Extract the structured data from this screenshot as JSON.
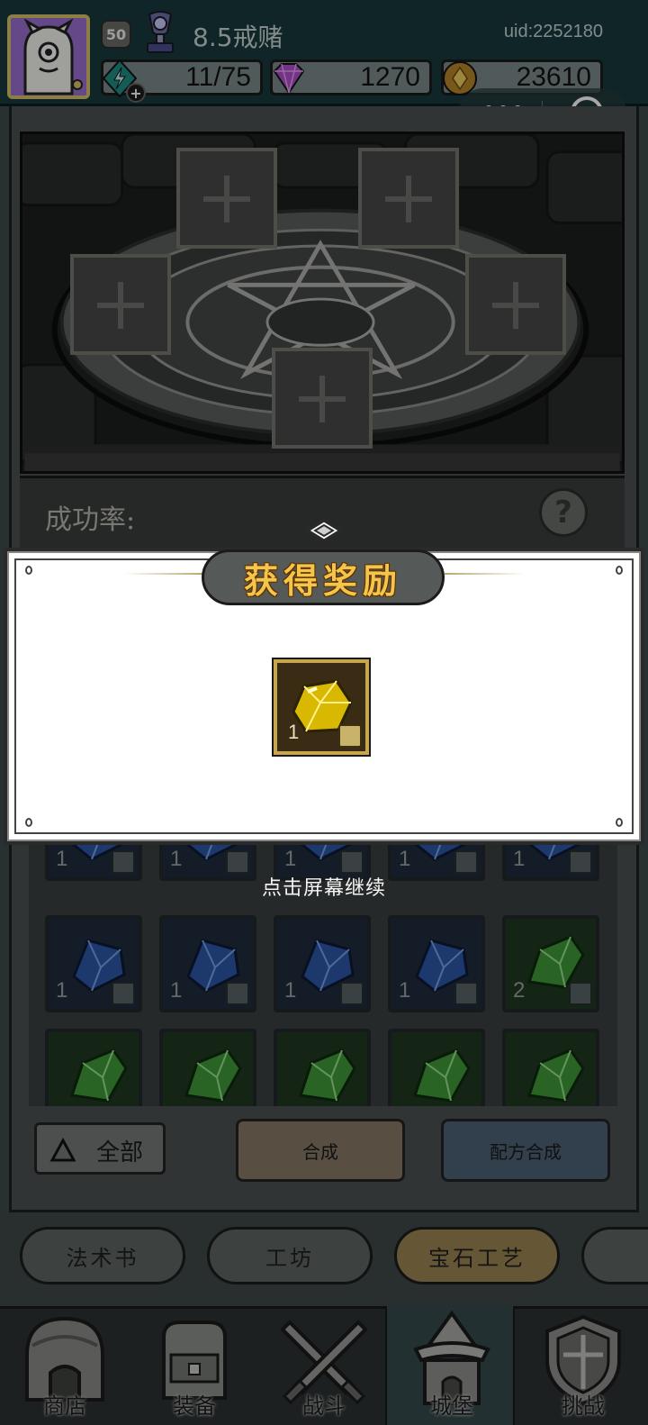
{
  "header": {
    "level": "50",
    "player_name": "8.5戒赌",
    "uid": "uid:2252180",
    "resources": {
      "energy": "11/75",
      "gems": "1270",
      "gold": "23610"
    },
    "capsule_dots": "•••"
  },
  "altar": {
    "slot_count": 5
  },
  "success_rate": {
    "label": "成功率:",
    "help": "?"
  },
  "reward_modal": {
    "title": "获得奖励",
    "item": {
      "name": "yellow-gem",
      "qty": "1",
      "color": "#e6c400"
    },
    "continue_hint": "点击屏幕继续"
  },
  "inventory": {
    "rows": [
      [
        {
          "color": "blue",
          "qty": "1"
        },
        {
          "color": "blue",
          "qty": "1"
        },
        {
          "color": "blue",
          "qty": "1"
        },
        {
          "color": "blue",
          "qty": "1"
        },
        {
          "color": "blue",
          "qty": "1"
        }
      ],
      [
        {
          "color": "blue",
          "qty": "1"
        },
        {
          "color": "blue",
          "qty": "1"
        },
        {
          "color": "blue",
          "qty": "1"
        },
        {
          "color": "blue",
          "qty": "1"
        },
        {
          "color": "green",
          "qty": "2"
        }
      ],
      [
        {
          "color": "green",
          "qty": ""
        },
        {
          "color": "green",
          "qty": ""
        },
        {
          "color": "green",
          "qty": ""
        },
        {
          "color": "green",
          "qty": ""
        },
        {
          "color": "green",
          "qty": ""
        }
      ]
    ]
  },
  "controls": {
    "filter_label": "全部",
    "synthesize_label": "合成",
    "recipe_label": "配方合成"
  },
  "tabs": [
    {
      "label": "法术书",
      "active": false
    },
    {
      "label": "工坊",
      "active": false
    },
    {
      "label": "宝石工艺",
      "active": true
    }
  ],
  "bottom_nav": [
    {
      "label": "商店",
      "icon": "shop-icon"
    },
    {
      "label": "装备",
      "icon": "backpack-icon"
    },
    {
      "label": "战斗",
      "icon": "crossed-swords-icon"
    },
    {
      "label": "城堡",
      "icon": "castle-icon",
      "active": true
    },
    {
      "label": "挑战",
      "icon": "shield-icon"
    }
  ],
  "colors": {
    "topbar": "#17393c",
    "accent_gold": "#f3c54a",
    "active_tab": "#9c8452",
    "recipe_button": "#4d6177"
  }
}
